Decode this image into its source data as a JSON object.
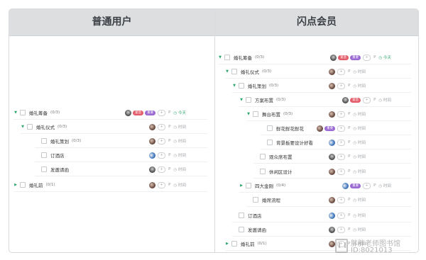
{
  "columns": {
    "left": {
      "title": "普通用户"
    },
    "right": {
      "title": "闪点会员"
    }
  },
  "labels": {
    "add": "+",
    "flag": "P",
    "time": "时间",
    "today": "今天",
    "clock": "◷"
  },
  "left_tasks": [
    {
      "name": "婚礼筹备",
      "count": "(0/3)",
      "expanded": true,
      "tags": [
        "紧急",
        "重要"
      ],
      "avatar": "c",
      "today": true
    },
    {
      "name": "婚礼仪式",
      "count": "(0/3)",
      "expanded": true,
      "tags": [],
      "avatar": "a",
      "today": false
    },
    {
      "name": "婚礼策划",
      "count": "(0/3)",
      "expanded": null,
      "tags": [],
      "avatar": "a",
      "today": false
    },
    {
      "name": "订酒店",
      "count": "",
      "expanded": null,
      "tags": [],
      "avatar": "b",
      "today": false
    },
    {
      "name": "发邀请函",
      "count": "",
      "expanded": null,
      "tags": [],
      "avatar": "c",
      "today": false
    },
    {
      "name": "婚礼前",
      "count": "(0/1)",
      "expanded": false,
      "tags": [],
      "avatar": "a",
      "today": false
    }
  ],
  "right_tasks": [
    {
      "name": "婚礼筹备",
      "count": "(0/3)",
      "expanded": true,
      "tags": [
        "紧急",
        "重要"
      ],
      "avatar": "c",
      "today": true
    },
    {
      "name": "婚礼仪式",
      "count": "(0/3)",
      "expanded": true,
      "tags": [],
      "avatar": "a",
      "today": false
    },
    {
      "name": "婚礼策划",
      "count": "(0/3)",
      "expanded": true,
      "tags": [],
      "avatar": "a",
      "today": false
    },
    {
      "name": "方案布置",
      "count": "(0/3)",
      "expanded": true,
      "tags": [
        "紧急"
      ],
      "avatar": "c",
      "today": false
    },
    {
      "name": "舞台布置",
      "count": "(0/3)",
      "expanded": true,
      "tags": [],
      "avatar": "a",
      "today": false
    },
    {
      "name": "鲜花鲜花鲜花",
      "count": "",
      "expanded": null,
      "tags": [
        "重要"
      ],
      "avatar": "a",
      "today": false
    },
    {
      "name": "背景板要设计好看",
      "count": "",
      "expanded": null,
      "tags": [],
      "avatar": "b",
      "today": false
    },
    {
      "name": "观众席布置",
      "count": "",
      "expanded": null,
      "tags": [],
      "avatar": "c",
      "today": false
    },
    {
      "name": "休闲区设计",
      "count": "",
      "expanded": null,
      "tags": [],
      "avatar": "a",
      "today": false
    },
    {
      "name": "四大金刚",
      "count": "(0/4)",
      "expanded": false,
      "tags": [
        "重要"
      ],
      "avatar": "b",
      "today": false
    },
    {
      "name": "婚席流程",
      "count": "",
      "expanded": null,
      "tags": [],
      "avatar": "a",
      "today": false
    },
    {
      "name": "订酒店",
      "count": "",
      "expanded": null,
      "tags": [],
      "avatar": "b",
      "today": false
    },
    {
      "name": "发邀请函",
      "count": "",
      "expanded": null,
      "tags": [],
      "avatar": "c",
      "today": false
    },
    {
      "name": "婚礼前",
      "count": "(0/1)",
      "expanded": false,
      "tags": [],
      "avatar": "a",
      "today": false
    }
  ],
  "tag_colors": {
    "紧急": "#e35d6a",
    "重要": "#9a6ad2"
  },
  "accent": "#2aa36a",
  "watermark": {
    "line1": "胖胖老师图书馆",
    "line2": "ID:8021013"
  }
}
